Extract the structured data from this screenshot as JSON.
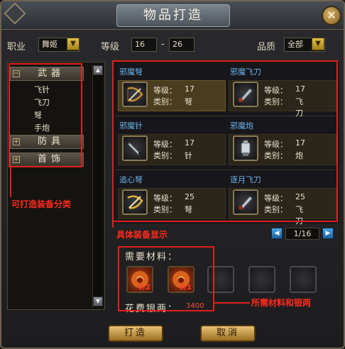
{
  "window": {
    "title": "物品打造",
    "close_glyph": "✕"
  },
  "filters": {
    "profession_label": "职业",
    "profession_value": "舞姬",
    "level_label": "等级",
    "level_min": "16",
    "level_sep": "-",
    "level_max": "26",
    "quality_label": "品质",
    "quality_value": "全部"
  },
  "categories": [
    {
      "label": "武器",
      "expanded": true,
      "toggle": "−",
      "children": [
        "飞针",
        "飞刀",
        "弩",
        "手炮"
      ]
    },
    {
      "label": "防具",
      "expanded": false,
      "toggle": "+"
    },
    {
      "label": "首饰",
      "expanded": false,
      "toggle": "+"
    }
  ],
  "items": [
    {
      "name": "邪魔弩",
      "level_label": "等级：",
      "level": "17",
      "type_label": "类别：",
      "type": "弩",
      "icon": "crossbow-icon",
      "selected": true
    },
    {
      "name": "邪魔飞刀",
      "level_label": "等级：",
      "level": "17",
      "type_label": "类别：",
      "type": "飞刀",
      "icon": "throwing-knife-icon",
      "selected": false
    },
    {
      "name": "邪魔针",
      "level_label": "等级：",
      "level": "17",
      "type_label": "类别：",
      "type": "针",
      "icon": "needle-icon",
      "selected": false
    },
    {
      "name": "邪魔炮",
      "level_label": "等级：",
      "level": "17",
      "type_label": "类别：",
      "type": "炮",
      "icon": "hand-cannon-icon",
      "selected": false
    },
    {
      "name": "追心弩",
      "level_label": "等级：",
      "level": "25",
      "type_label": "类别：",
      "type": "弩",
      "icon": "golden-crossbow-icon",
      "selected": false
    },
    {
      "name": "逐月飞刀",
      "level_label": "等级：",
      "level": "25",
      "type_label": "类别：",
      "type": "飞刀",
      "icon": "throwing-knife-icon",
      "selected": false
    }
  ],
  "pagination": {
    "current": "1/16",
    "prev_glyph": "◀",
    "next_glyph": "▶"
  },
  "materials": {
    "title": "需要材料：",
    "slots": [
      {
        "count": "0/2",
        "icon": "fire-orb-icon",
        "filled": true
      },
      {
        "count": "0/1",
        "icon": "fire-orb-icon",
        "filled": true
      },
      {
        "count": "",
        "icon": "empty-slot",
        "filled": false
      },
      {
        "count": "",
        "icon": "empty-slot",
        "filled": false
      },
      {
        "count": "",
        "icon": "empty-slot",
        "filled": false
      }
    ],
    "cost_label": "花费银两：",
    "cost_value": "3400"
  },
  "buttons": {
    "craft": "打造",
    "cancel": "取消"
  },
  "annotations": {
    "categories_note": "可打造装备分类",
    "items_note": "具体装备显示",
    "materials_note": "所需材料和银两"
  },
  "colors": {
    "accent_gold": "#e1c14a",
    "item_name_blue": "#6cb3ea",
    "annotation_red": "#e0201a",
    "count_red": "#ff3a2a"
  }
}
